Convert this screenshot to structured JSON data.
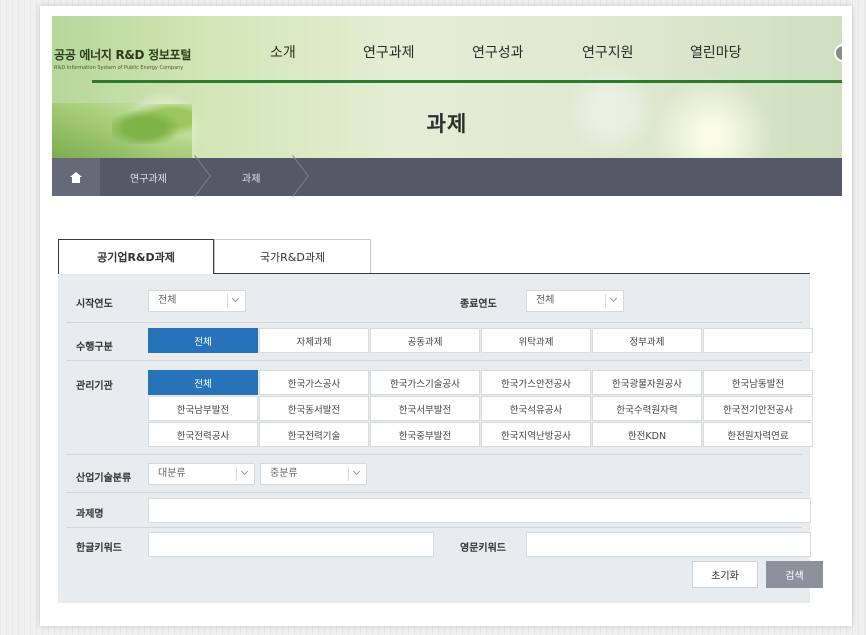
{
  "header": {
    "logo_title": "공공 에너지 R&D 정보포털",
    "logo_subtitle": "R&D Information System of Public Energy Company",
    "nav": [
      "소개",
      "연구과제",
      "연구성과",
      "연구지원",
      "열린마당"
    ],
    "page_title": "과제"
  },
  "breadcrumb": {
    "items": [
      "연구과제",
      "과제"
    ]
  },
  "tabs": [
    "공기업R&D과제",
    "국가R&D과제"
  ],
  "filters": {
    "start_year": {
      "label": "시작연도",
      "value": "전체"
    },
    "end_year": {
      "label": "종료연도",
      "value": "전체"
    },
    "type": {
      "label": "수행구분",
      "options": [
        "전체",
        "자체과제",
        "공동과제",
        "위탁과제",
        "정부과제",
        ""
      ]
    },
    "agency": {
      "label": "관리기관",
      "options": [
        "전체",
        "한국가스공사",
        "한국가스기술공사",
        "한국가스안전공사",
        "한국광물자원공사",
        "한국남동발전",
        "한국남부발전",
        "한국동서발전",
        "한국서부발전",
        "한국석유공사",
        "한국수력원자력",
        "한국전기안전공사",
        "한국전력공사",
        "한국전력기술",
        "한국중부발전",
        "한국지역난방공사",
        "한전KDN",
        "한전원자력연료"
      ]
    },
    "industry": {
      "label": "산업기술분류",
      "major": "대분류",
      "minor": "중분류"
    },
    "project_name": {
      "label": "과제명",
      "value": ""
    },
    "kor_keyword": {
      "label": "한글키워드",
      "value": ""
    },
    "eng_keyword": {
      "label": "영문키워드",
      "value": ""
    }
  },
  "buttons": {
    "reset": "초기화",
    "search": "검색"
  }
}
